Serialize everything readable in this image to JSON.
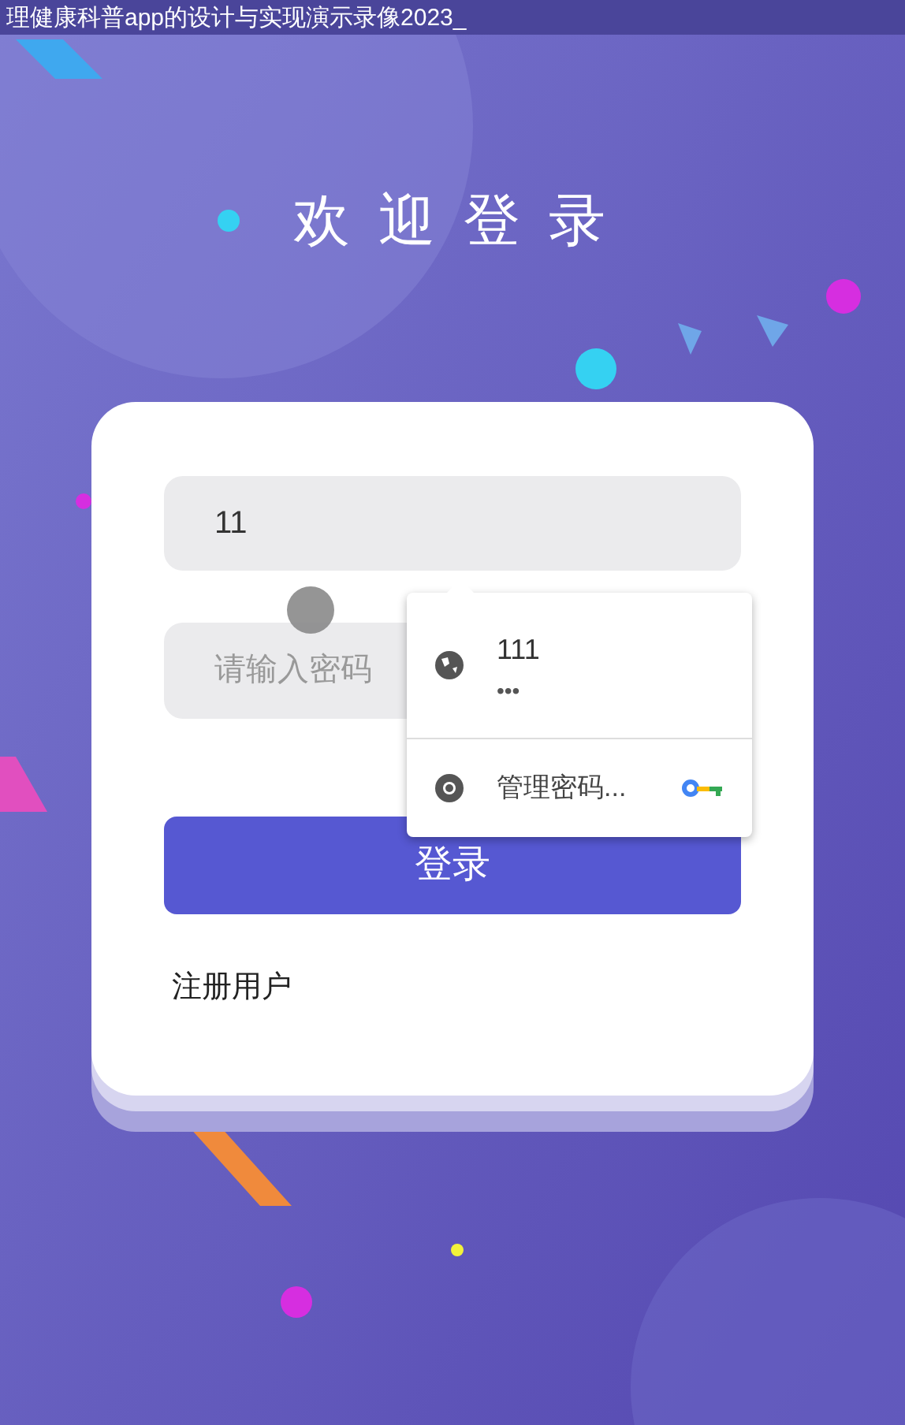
{
  "video_title": "理健康科普app的设计与实现演示录像2023_",
  "heading": "欢 迎 登 录",
  "username": {
    "value": "11"
  },
  "password": {
    "placeholder": "请输入密码"
  },
  "autofill": {
    "items": [
      {
        "kind": "credential",
        "username": "111",
        "password": "•••"
      },
      {
        "kind": "manage",
        "label": "管理密码..."
      }
    ]
  },
  "login_button": "登录",
  "register_link": "注册用户"
}
